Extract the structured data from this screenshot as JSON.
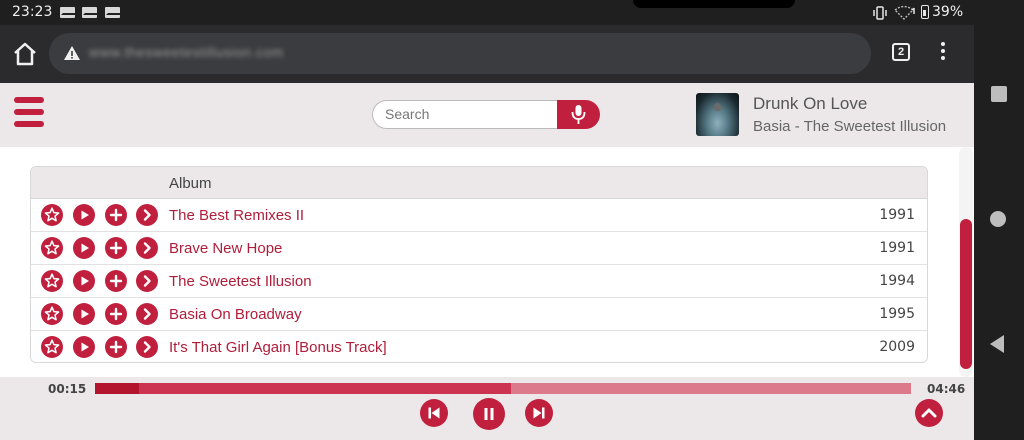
{
  "status_bar": {
    "time": "23:23",
    "battery": "39%"
  },
  "browser": {
    "url": "www.thesweetestillusion.com",
    "tab_count": "2"
  },
  "search": {
    "placeholder": "Search"
  },
  "now_playing": {
    "title": "Drunk On Love",
    "subtitle": "Basia - The Sweetest Illusion"
  },
  "table": {
    "column_header": "Album",
    "rows": [
      {
        "title": "The Best Remixes II",
        "year": "1991"
      },
      {
        "title": "Brave New Hope",
        "year": "1991"
      },
      {
        "title": "The Sweetest Illusion",
        "year": "1994"
      },
      {
        "title": "Basia On Broadway",
        "year": "1995"
      },
      {
        "title": "It's That Girl Again [Bonus Track]",
        "year": "2009"
      }
    ]
  },
  "player": {
    "current_time": "00:15",
    "total_time": "04:46",
    "progress_fraction": 0.054,
    "buffered_fraction": 0.51
  },
  "colors": {
    "accent": "#c0203e",
    "header_bg": "#ece8e9",
    "link_text": "#b01d3a"
  },
  "icons": {
    "row_actions": [
      "star-icon",
      "play-icon",
      "plus-icon",
      "chevron-right-icon"
    ],
    "player_controls": [
      "skip-previous-icon",
      "pause-icon",
      "skip-next-icon",
      "chevron-up-icon"
    ]
  }
}
